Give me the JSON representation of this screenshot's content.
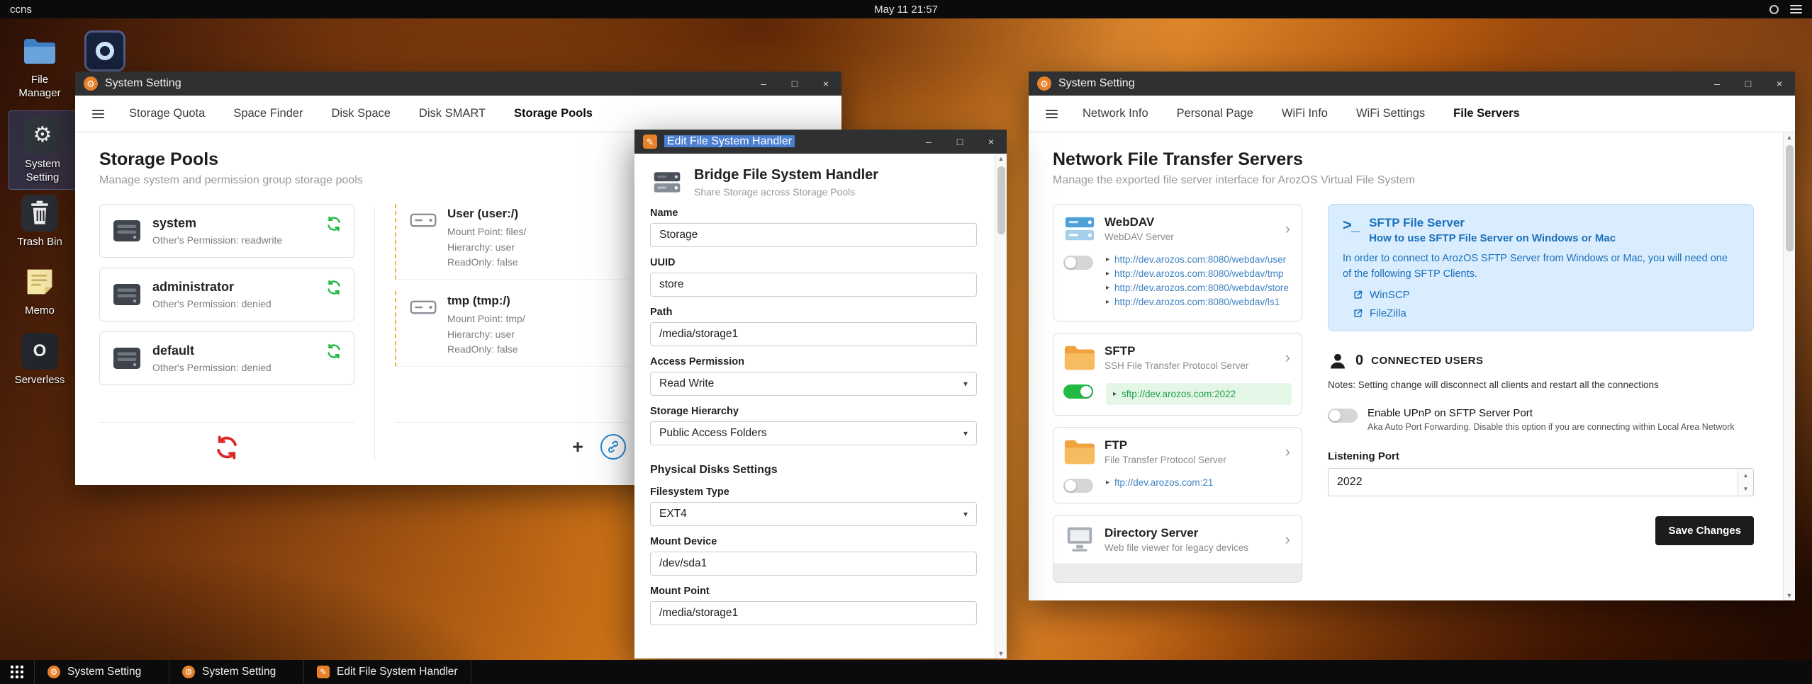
{
  "topbar": {
    "host": "ccns",
    "clock": "May 11 21:57"
  },
  "desktop_icons": {
    "file_manager": "File Manager",
    "system_setting": "System Setting",
    "trash_bin": "Trash Bin",
    "memo": "Memo",
    "serverless": "Serverless"
  },
  "win_storage": {
    "title": "System Setting",
    "tabs": [
      "Storage Quota",
      "Space Finder",
      "Disk Space",
      "Disk SMART",
      "Storage Pools"
    ],
    "heading": "Storage Pools",
    "subheading": "Manage system and permission group storage pools",
    "pools": [
      {
        "name": "system",
        "desc": "Other's Permission: readwrite"
      },
      {
        "name": "administrator",
        "desc": "Other's Permission: denied"
      },
      {
        "name": "default",
        "desc": "Other's Permission: denied"
      }
    ],
    "mounts": [
      {
        "name": "User (user:/)",
        "line1": "Mount Point: files/",
        "line2": "Hierarchy: user",
        "line3": "ReadOnly: false"
      },
      {
        "name": "tmp (tmp:/)",
        "line1": "Mount Point: tmp/",
        "line2": "Hierarchy: user",
        "line3": "ReadOnly: false"
      }
    ]
  },
  "win_edit": {
    "title": "Edit File System Handler",
    "header": "Bridge File System Handler",
    "subheader": "Share Storage across Storage Pools",
    "name_label": "Name",
    "name_value": "Storage",
    "uuid_label": "UUID",
    "uuid_value": "store",
    "path_label": "Path",
    "path_value": "/media/storage1",
    "access_label": "Access Permission",
    "access_value": "Read Write",
    "hierarchy_label": "Storage Hierarchy",
    "hierarchy_value": "Public Access Folders",
    "section_disks": "Physical Disks Settings",
    "fstype_label": "Filesystem Type",
    "fstype_value": "EXT4",
    "mount_device_label": "Mount Device",
    "mount_device_value": "/dev/sda1",
    "mount_point_label": "Mount Point",
    "mount_point_value": "/media/storage1"
  },
  "win_servers": {
    "title": "System Setting",
    "tabs": [
      "Network Info",
      "Personal Page",
      "WiFi Info",
      "WiFi Settings",
      "File Servers"
    ],
    "heading": "Network File Transfer Servers",
    "subheading": "Manage the exported file server interface for ArozOS Virtual File System",
    "webdav": {
      "name": "WebDAV",
      "desc": "WebDAV Server",
      "links": [
        "http://dev.arozos.com:8080/webdav/user",
        "http://dev.arozos.com:8080/webdav/tmp",
        "http://dev.arozos.com:8080/webdav/store",
        "http://dev.arozos.com:8080/webdav/ls1"
      ]
    },
    "sftp": {
      "name": "SFTP",
      "desc": "SSH File Transfer Protocol Server",
      "link": "sftp://dev.arozos.com:2022"
    },
    "ftp": {
      "name": "FTP",
      "desc": "File Transfer Protocol Server",
      "link": "ftp://dev.arozos.com:21"
    },
    "dirserver": {
      "name": "Directory Server",
      "desc": "Web file viewer for legacy devices"
    },
    "info": {
      "title": "SFTP File Server",
      "subtitle": "How to use SFTP File Server on Windows or Mac",
      "body": "In order to connect to ArozOS SFTP Server from Windows or Mac, you will need one of the following SFTP Clients.",
      "client1": "WinSCP",
      "client2": "FileZilla"
    },
    "connected_count": "0",
    "connected_label": "CONNECTED USERS",
    "connected_notes": "Notes: Setting change will disconnect all clients and restart all the connections",
    "upnp_label": "Enable UPnP on SFTP Server Port",
    "upnp_desc": "Aka Auto Port Forwarding. Disable this option if you are connecting within Local Area Network",
    "port_label": "Listening Port",
    "port_value": "2022",
    "save_label": "Save Changes"
  },
  "taskbar": {
    "item1": "System Setting",
    "item2": "System Setting",
    "item3": "Edit File System Handler"
  },
  "icons": {
    "minimize": "–",
    "maximize": "□",
    "close": "×",
    "chevron_right": "›",
    "caret_down": "▾",
    "link_arrow": "▸",
    "plus": "+",
    "gear": "⚙",
    "pencil": "✎",
    "terminal_prompt": ">_",
    "spin_up": "▲",
    "spin_down": "▼",
    "serverless_glyph": "O"
  },
  "colors": {
    "accent_green": "#21ba45",
    "link_blue": "#4183c4",
    "danger_red": "#db2828",
    "folder_orange": "#efa23d",
    "info_blue": "#1c6fb8",
    "button_dark": "#1b1c1d",
    "titlebar": "#2f3032",
    "taskbar": "#0b0b0c"
  }
}
